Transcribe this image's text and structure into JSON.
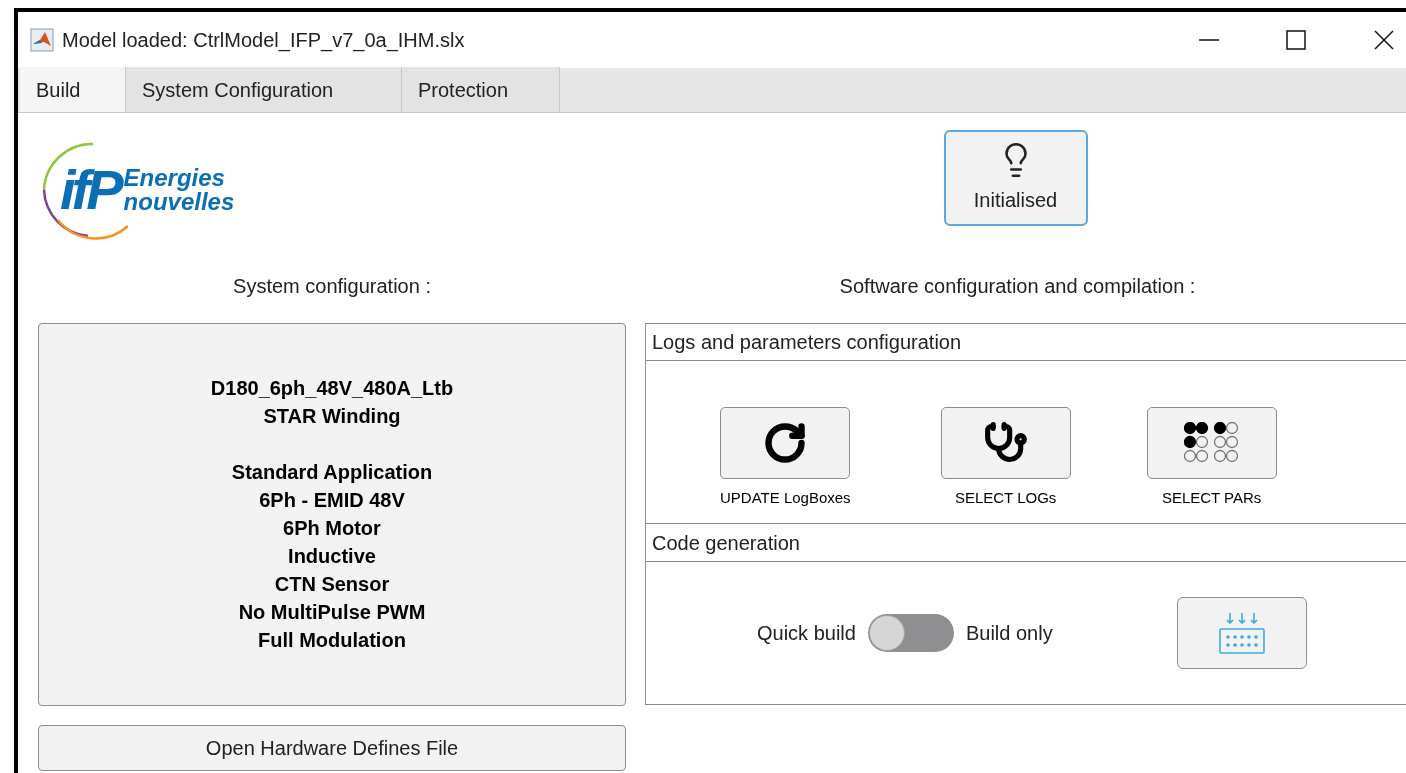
{
  "window": {
    "title": "Model loaded: CtrlModel_IFP_v7_0a_IHM.slx"
  },
  "tabs": [
    {
      "label": "Build",
      "selected": true
    },
    {
      "label": "System Configuration",
      "selected": false
    },
    {
      "label": "Protection",
      "selected": false
    }
  ],
  "logo": {
    "mark": "ifP",
    "line_1": "Energies",
    "line_2": "nouvelles"
  },
  "status_button": {
    "label": "Initialised"
  },
  "system_configuration": {
    "heading": "System configuration :",
    "line_groups": [
      [
        "D180_6ph_48V_480A_Ltb",
        "STAR Winding"
      ],
      [
        "Standard Application",
        "6Ph - EMID 48V",
        "6Ph Motor",
        "Inductive",
        "CTN Sensor",
        "No MultiPulse PWM",
        "Full Modulation"
      ]
    ],
    "button": "Open Hardware Defines File"
  },
  "software": {
    "heading": "Software configuration and compilation :",
    "logs_panel": {
      "title": "Logs and parameters configuration",
      "buttons": [
        {
          "kind": "refresh",
          "label": "UPDATE LogBoxes"
        },
        {
          "kind": "stethoscope",
          "label": "SELECT LOGs"
        },
        {
          "kind": "dots",
          "label": "SELECT PARs"
        }
      ]
    },
    "code_panel": {
      "title": "Code generation",
      "switch": {
        "left_label": "Quick build",
        "right_label": "Build only",
        "on": false
      }
    }
  }
}
